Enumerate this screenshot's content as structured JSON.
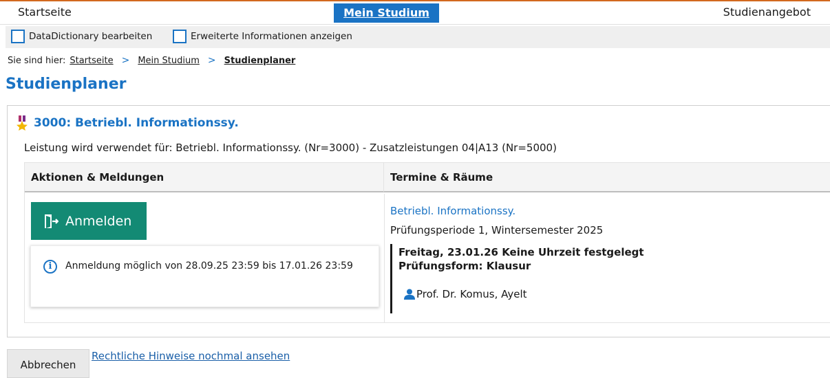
{
  "topnav": {
    "home": "Startseite",
    "my_study": "Mein Studium",
    "offerings": "Studienangebot"
  },
  "options": {
    "datadictionary": "DataDictionary bearbeiten",
    "extended_info": "Erweiterte Informationen anzeigen"
  },
  "breadcrumb": {
    "prefix": "Sie sind hier:",
    "items": [
      "Startseite",
      "Mein Studium",
      "Studienplaner"
    ]
  },
  "page_title": "Studienplaner",
  "course": {
    "title": "3000: Betriebl. Informationssy.",
    "usage": "Leistung wird verwendet für: Betriebl. Informationssy. (Nr=3000) - Zusatzleistungen 04|A13 (Nr=5000)",
    "columns": [
      "Aktionen & Meldungen",
      "Termine & Räume"
    ],
    "register_button": "Anmelden",
    "registration_info": "Anmeldung möglich von 28.09.25 23:59 bis 17.01.26 23:59",
    "exam": {
      "name": "Betriebl. Informationssy.",
      "period": "Prüfungsperiode 1, Wintersemester 2025",
      "date": "Freitag, 23.01.26 Keine Uhrzeit festgelegt",
      "form": "Prüfungsform: Klausur",
      "examiner": "Prof. Dr. Komus, Ayelt"
    }
  },
  "footer": {
    "cancel": "Abbrechen",
    "legal": "Rechtliche Hinweise nochmal ansehen"
  },
  "icons": [
    "medal-icon",
    "door-enter-icon",
    "info-icon",
    "person-icon"
  ],
  "colors": {
    "accent": "#1a73c4",
    "register_button": "#138a74",
    "topnav_border": "#d2691e"
  }
}
